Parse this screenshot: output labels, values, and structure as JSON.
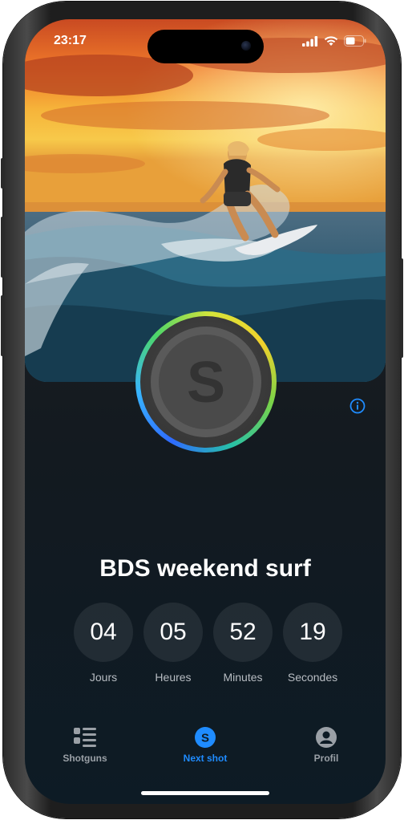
{
  "status_bar": {
    "time": "23:17",
    "icons": [
      "cellular-signal-icon",
      "wifi-icon",
      "battery-icon"
    ]
  },
  "event": {
    "title": "BDS weekend surf",
    "logo_letter": "S",
    "countdown": [
      {
        "value": "04",
        "label": "Jours"
      },
      {
        "value": "05",
        "label": "Heures"
      },
      {
        "value": "52",
        "label": "Minutes"
      },
      {
        "value": "19",
        "label": "Secondes"
      }
    ]
  },
  "tabbar": {
    "tabs": [
      {
        "label": "Shotguns",
        "icon": "list-icon",
        "active": false
      },
      {
        "label": "Next shot",
        "icon": "s-logo-icon",
        "active": true
      },
      {
        "label": "Profil",
        "icon": "profile-icon",
        "active": false
      }
    ]
  },
  "colors": {
    "accent": "#1f8cff",
    "inactive_tab": "#9aa0a6",
    "ring": [
      "#2f6bff",
      "#38b5ff",
      "#4cd66a",
      "#f1d12c"
    ]
  }
}
